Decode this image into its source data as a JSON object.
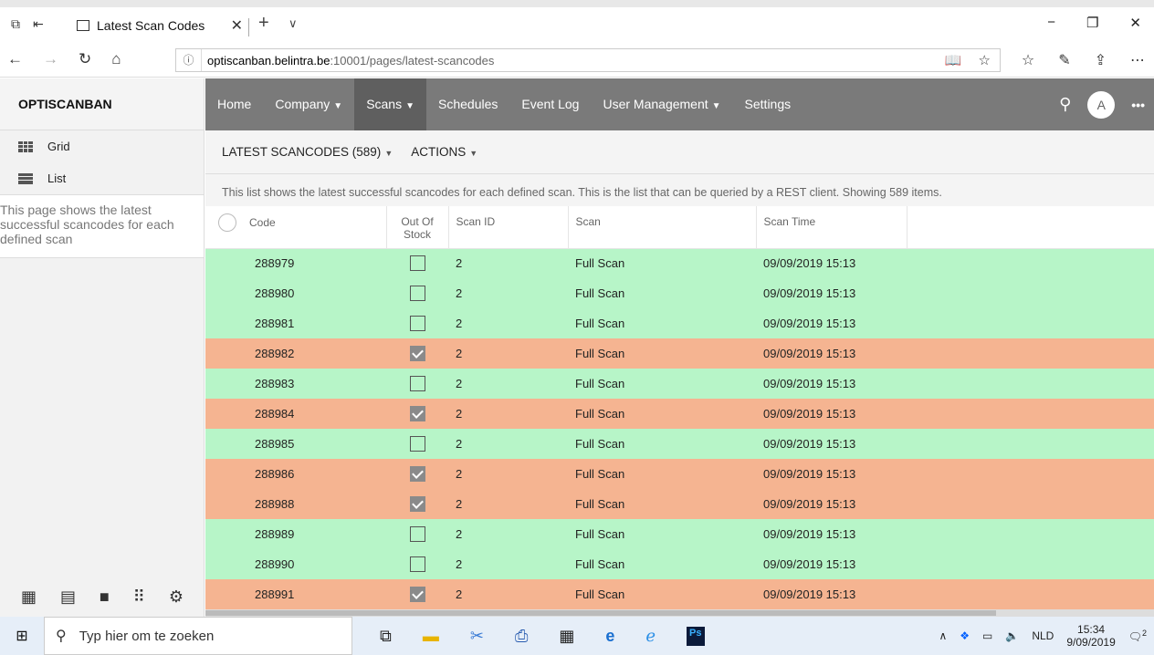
{
  "browser": {
    "tab_title": "Latest Scan Codes",
    "url_host": "optiscanban.belintra.be",
    "url_rest": ":10001/pages/latest-scancodes"
  },
  "sidebar": {
    "brand": "OPTISCANBAN",
    "items": [
      {
        "label": "Grid",
        "icon": "grid-icon"
      },
      {
        "label": "List",
        "icon": "list-icon"
      }
    ],
    "description": "This page shows the latest successful scancodes for each defined scan"
  },
  "topnav": {
    "items": [
      "Home",
      "Company",
      "Scans",
      "Schedules",
      "Event Log",
      "User Management",
      "Settings"
    ],
    "avatar": "A"
  },
  "subbar": {
    "title": "LATEST SCANCODES (589)",
    "actions": "ACTIONS"
  },
  "info": "This list shows the latest successful scancodes for each defined scan. This is the list that can be queried by a REST client. Showing 589 items.",
  "table": {
    "headers": {
      "code": "Code",
      "oos_1": "Out Of",
      "oos_2": "Stock",
      "scan_id": "Scan ID",
      "scan": "Scan",
      "scan_time": "Scan Time"
    },
    "colors": {
      "in_stock": "#b7f5c8",
      "out_of_stock": "#f5b491"
    },
    "rows": [
      {
        "code": "288979",
        "oos": false,
        "scan_id": "2",
        "scan": "Full Scan",
        "time": "09/09/2019 15:13"
      },
      {
        "code": "288980",
        "oos": false,
        "scan_id": "2",
        "scan": "Full Scan",
        "time": "09/09/2019 15:13"
      },
      {
        "code": "288981",
        "oos": false,
        "scan_id": "2",
        "scan": "Full Scan",
        "time": "09/09/2019 15:13"
      },
      {
        "code": "288982",
        "oos": true,
        "scan_id": "2",
        "scan": "Full Scan",
        "time": "09/09/2019 15:13"
      },
      {
        "code": "288983",
        "oos": false,
        "scan_id": "2",
        "scan": "Full Scan",
        "time": "09/09/2019 15:13"
      },
      {
        "code": "288984",
        "oos": true,
        "scan_id": "2",
        "scan": "Full Scan",
        "time": "09/09/2019 15:13"
      },
      {
        "code": "288985",
        "oos": false,
        "scan_id": "2",
        "scan": "Full Scan",
        "time": "09/09/2019 15:13"
      },
      {
        "code": "288986",
        "oos": true,
        "scan_id": "2",
        "scan": "Full Scan",
        "time": "09/09/2019 15:13"
      },
      {
        "code": "288988",
        "oos": true,
        "scan_id": "2",
        "scan": "Full Scan",
        "time": "09/09/2019 15:13"
      },
      {
        "code": "288989",
        "oos": false,
        "scan_id": "2",
        "scan": "Full Scan",
        "time": "09/09/2019 15:13"
      },
      {
        "code": "288990",
        "oos": false,
        "scan_id": "2",
        "scan": "Full Scan",
        "time": "09/09/2019 15:13"
      },
      {
        "code": "288991",
        "oos": true,
        "scan_id": "2",
        "scan": "Full Scan",
        "time": "09/09/2019 15:13"
      }
    ]
  },
  "taskbar": {
    "search_placeholder": "Typ hier om te zoeken",
    "language": "NLD",
    "time": "15:34",
    "date": "9/09/2019",
    "notification_count": "2"
  }
}
